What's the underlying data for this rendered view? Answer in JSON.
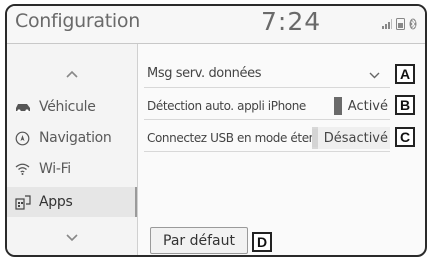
{
  "header": {
    "title": "Configuration",
    "clock": "7:24",
    "status_icons": [
      "signal-icon",
      "phone-battery-icon",
      "bluetooth-icon"
    ]
  },
  "sidebar": {
    "up_arrow": "chevron-up-icon",
    "items": [
      {
        "label": "Véhicule",
        "icon": "car-icon"
      },
      {
        "label": "Navigation",
        "icon": "compass-icon"
      },
      {
        "label": "Wi-Fi",
        "icon": "wifi-icon"
      },
      {
        "label": "Apps",
        "icon": "apps-icon",
        "active": true
      }
    ],
    "down_arrow": "chevron-down-icon"
  },
  "main": {
    "rows": [
      {
        "label": "Msg serv. données",
        "control": "dropdown",
        "callout": "A"
      },
      {
        "label": "Détection auto. appli iPhone",
        "state": "Activé",
        "on": true,
        "callout": "B"
      },
      {
        "label": "Connectez USB en mode étendu.",
        "state": "Désactivé",
        "on": false,
        "callout": "C"
      }
    ],
    "default_button": {
      "label": "Par défaut",
      "callout": "D"
    }
  },
  "colors": {
    "frame_border": "#2a2a2a",
    "header_text": "#6a6a6a",
    "toggle_on": "#6a6a6a",
    "toggle_off": "#d4d4d4"
  }
}
